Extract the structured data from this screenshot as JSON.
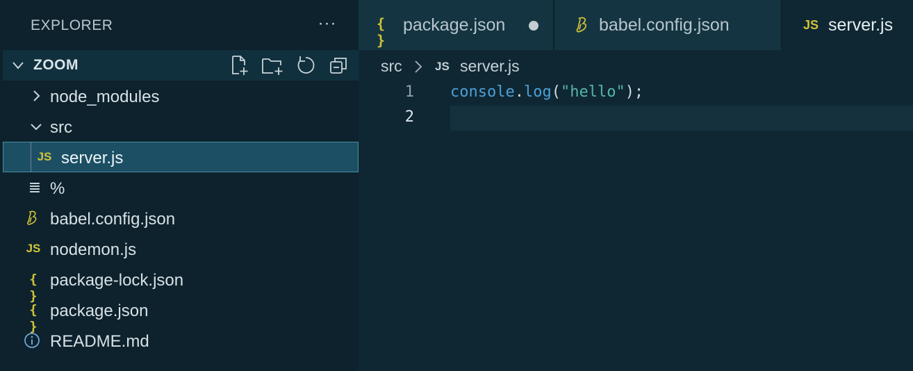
{
  "explorer": {
    "title": "EXPLORER",
    "more_actions": "···",
    "section": {
      "title": "ZOOM",
      "actions": [
        "new-file-icon",
        "new-folder-icon",
        "refresh-icon",
        "collapse-all-icon"
      ]
    },
    "tree": [
      {
        "label": "node_modules",
        "kind": "folder",
        "expanded": false
      },
      {
        "label": "src",
        "kind": "folder",
        "expanded": true
      },
      {
        "label": "server.js",
        "kind": "js",
        "selected": true
      },
      {
        "label": "%",
        "kind": "text"
      },
      {
        "label": "babel.config.json",
        "kind": "babel"
      },
      {
        "label": "nodemon.js",
        "kind": "js"
      },
      {
        "label": "package-lock.json",
        "kind": "json"
      },
      {
        "label": "package.json",
        "kind": "json"
      },
      {
        "label": "README.md",
        "kind": "info"
      }
    ]
  },
  "tabs": [
    {
      "label": "package.json",
      "icon": "json-icon",
      "dirty": true,
      "active": false
    },
    {
      "label": "babel.config.json",
      "icon": "babel-icon",
      "dirty": false,
      "active": false
    },
    {
      "label": "server.js",
      "icon": "js-icon",
      "dirty": false,
      "active": true
    }
  ],
  "icon_glyphs": {
    "js": "JS",
    "json": "{ }",
    "text": "≣"
  },
  "breadcrumb": {
    "folder": "src",
    "file": "server.js"
  },
  "editor": {
    "lines": [
      {
        "number": "1",
        "tokens": [
          {
            "text": "console",
            "color": "#4e9fd6"
          },
          {
            "text": ".",
            "color": "#d3dde2"
          },
          {
            "text": "log",
            "color": "#4e9fd6"
          },
          {
            "text": "(",
            "color": "#d3dde2"
          },
          {
            "text": "\"hello\"",
            "color": "#56b6a8"
          },
          {
            "text": ");",
            "color": "#d3dde2"
          }
        ]
      },
      {
        "number": "2",
        "tokens": []
      }
    ],
    "current_line": 2
  },
  "colors": {
    "accent_yellow": "#d2c33a",
    "selection": "#1c4f64",
    "background": "#0f2733"
  }
}
